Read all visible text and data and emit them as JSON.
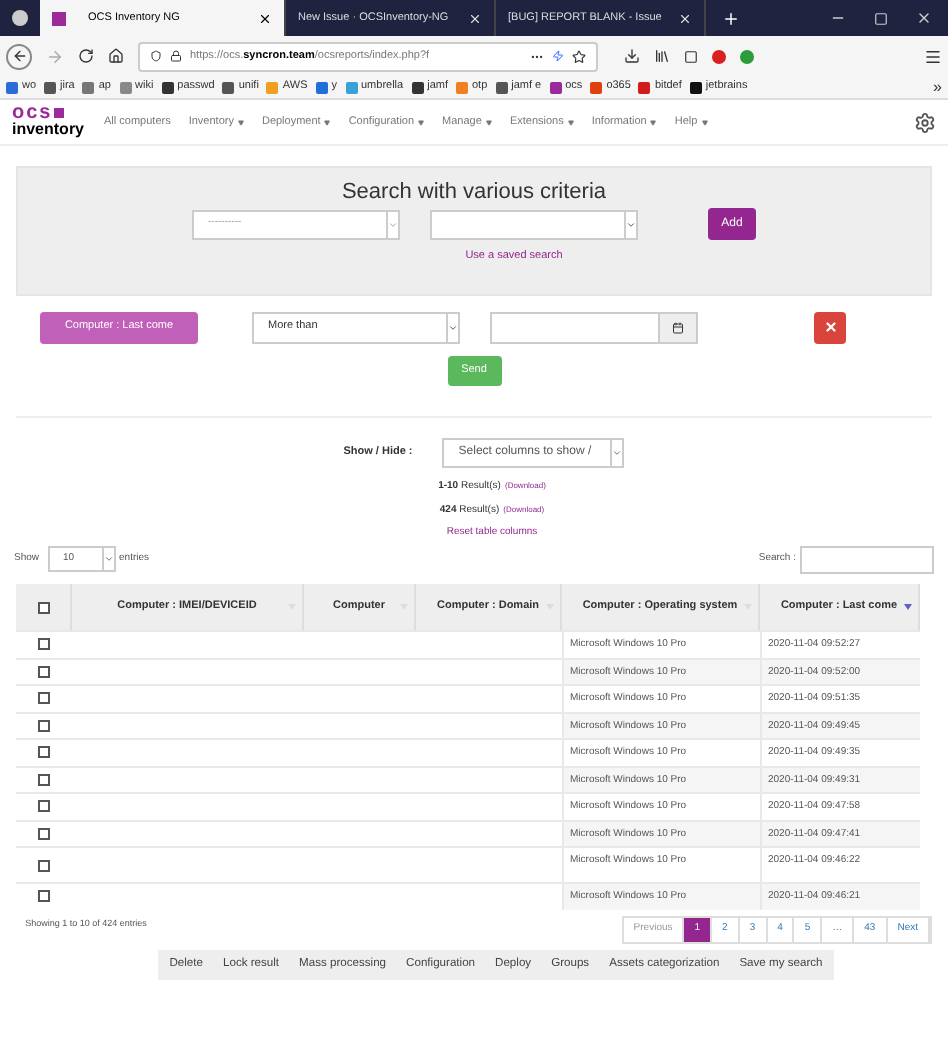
{
  "browser": {
    "tabs": [
      {
        "title": "OCS Inventory NG",
        "selected": true
      },
      {
        "title": "New Issue · OCSInventory-NG",
        "selected": false
      },
      {
        "title": "[BUG] REPORT BLANK - Issue",
        "selected": false
      }
    ],
    "url_prefix": "https://ocs.",
    "url_domain": "syncron.team",
    "url_rest": "/ocsreports/index.php?f",
    "bookmarks": [
      {
        "label": "wo",
        "color": "#2b6cd6"
      },
      {
        "label": "jira",
        "color": "#555555"
      },
      {
        "label": "ap",
        "color": "#777777"
      },
      {
        "label": "wiki",
        "color": "#888888"
      },
      {
        "label": "passwd",
        "color": "#333333"
      },
      {
        "label": "unifi",
        "color": "#555555"
      },
      {
        "label": "AWS",
        "color": "#f0a020"
      },
      {
        "label": "y",
        "color": "#1e6fd9"
      },
      {
        "label": "umbrella",
        "color": "#3aa0d8"
      },
      {
        "label": "jamf",
        "color": "#333333"
      },
      {
        "label": "otp",
        "color": "#f08020"
      },
      {
        "label": "jamf e",
        "color": "#555555"
      },
      {
        "label": "ocs",
        "color": "#9b2a9b"
      },
      {
        "label": "o365",
        "color": "#e04010"
      },
      {
        "label": "bitdef",
        "color": "#d01c1c"
      },
      {
        "label": "jetbrains",
        "color": "#111111"
      }
    ],
    "bookmarks_more": "»"
  },
  "app": {
    "logo_top": "ocs",
    "logo_bottom": "inventory",
    "nav": [
      {
        "label": "All computers",
        "dropdown": false
      },
      {
        "label": "Inventory",
        "dropdown": true
      },
      {
        "label": "Deployment",
        "dropdown": true
      },
      {
        "label": "Configuration",
        "dropdown": true
      },
      {
        "label": "Manage",
        "dropdown": true
      },
      {
        "label": "Extensions",
        "dropdown": true
      },
      {
        "label": "Information",
        "dropdown": true
      },
      {
        "label": "Help",
        "dropdown": true
      }
    ]
  },
  "search_panel": {
    "title": "Search with various criteria",
    "field_1": "----------",
    "add_button": "Add",
    "saved_search_link": "Use a saved search"
  },
  "criterion": {
    "label": "Computer : Last come",
    "operator": "More than",
    "send_button": "Send"
  },
  "columns_toggle": {
    "label": "Show / Hide :",
    "value": "Select columns to show /"
  },
  "results": [
    {
      "count": "1-10",
      "text": "Result(s)",
      "link": "(Download)"
    },
    {
      "count": "424",
      "text": "Result(s)",
      "link": "(Download)"
    }
  ],
  "reset_link": "Reset table columns",
  "table": {
    "select_all_checked": false,
    "show_label": "Show",
    "page_size": "10",
    "entries_label": "entries",
    "search_label": "Search :",
    "columns": [
      {
        "label": "Computer : IMEI/DEVICEID",
        "sorted": false
      },
      {
        "label": "Computer",
        "sorted": false
      },
      {
        "label": "Computer : Domain",
        "sorted": false
      },
      {
        "label": "Computer : Operating system",
        "sorted": false
      },
      {
        "label": "Computer : Last come",
        "sorted": true
      }
    ],
    "rows": [
      {
        "checked": false,
        "os": "Microsoft Windows 10 Pro",
        "last_come": "2020-11-04 09:52:27"
      },
      {
        "checked": false,
        "os": "Microsoft Windows 10 Pro",
        "last_come": "2020-11-04 09:52:00"
      },
      {
        "checked": false,
        "os": "Microsoft Windows 10 Pro",
        "last_come": "2020-11-04 09:51:35"
      },
      {
        "checked": false,
        "os": "Microsoft Windows 10 Pro",
        "last_come": "2020-11-04 09:49:45"
      },
      {
        "checked": false,
        "os": "Microsoft Windows 10 Pro",
        "last_come": "2020-11-04 09:49:35"
      },
      {
        "checked": false,
        "os": "Microsoft Windows 10 Pro",
        "last_come": "2020-11-04 09:49:31"
      },
      {
        "checked": false,
        "os": "Microsoft Windows 10 Pro",
        "last_come": "2020-11-04 09:47:58"
      },
      {
        "checked": false,
        "os": "Microsoft Windows 10 Pro",
        "last_come": "2020-11-04 09:47:41"
      },
      {
        "checked": false,
        "os": "Microsoft Windows 10 Pro",
        "last_come": "2020-11-04 09:46:22"
      },
      {
        "checked": false,
        "os": "Microsoft Windows 10 Pro",
        "last_come": "2020-11-04 09:46:21"
      }
    ]
  },
  "footer": {
    "info": "Showing 1 to 10 of 424 entries",
    "pages": [
      {
        "label": "Previous",
        "selected": false
      },
      {
        "label": "1",
        "selected": true
      },
      {
        "label": "2",
        "selected": false
      },
      {
        "label": "3",
        "selected": false
      },
      {
        "label": "4",
        "selected": false
      },
      {
        "label": "5",
        "selected": false
      },
      {
        "label": "…",
        "selected": false
      },
      {
        "label": "43",
        "selected": false
      },
      {
        "label": "Next",
        "selected": false
      }
    ],
    "actions": [
      "Delete",
      "Lock result",
      "Mass processing",
      "Configuration",
      "Deploy",
      "Groups",
      "Assets categorization",
      "Save my search"
    ]
  }
}
